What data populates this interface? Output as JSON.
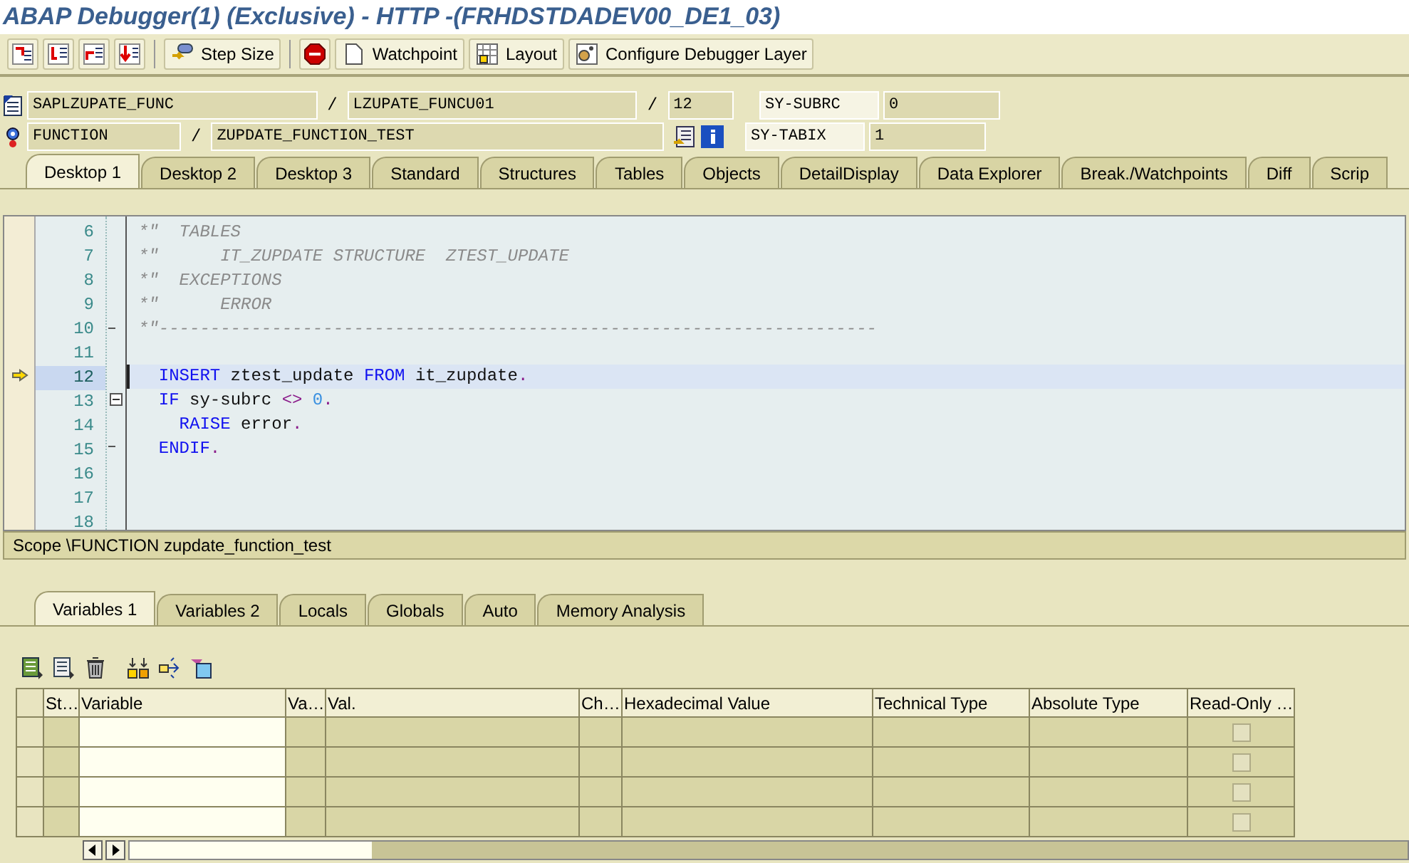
{
  "window": {
    "title": "ABAP Debugger(1)  (Exclusive) - HTTP -(FRHDSTDADEV00_DE1_03)"
  },
  "toolbar": [
    {
      "kind": "icon"
    },
    {
      "kind": "icon"
    },
    {
      "kind": "icon"
    },
    {
      "kind": "icon"
    },
    {
      "kind": "sep"
    },
    {
      "kind": "text",
      "label": "Step Size"
    },
    {
      "kind": "sep"
    },
    {
      "kind": "icon"
    },
    {
      "kind": "text",
      "label": "Watchpoint"
    },
    {
      "kind": "text",
      "label": "Layout"
    },
    {
      "kind": "text",
      "label": "Configure Debugger Layer"
    }
  ],
  "info_rows": [
    {
      "items": [
        {
          "kind": "field",
          "text": "SAPLZUPATE_FUNC"
        },
        {
          "kind": "sep",
          "text": "/"
        },
        {
          "kind": "field",
          "text": "LZUPATE_FUNCU01"
        },
        {
          "kind": "sep",
          "text": "/"
        },
        {
          "kind": "field",
          "text": "12"
        }
      ],
      "sy_name": "SY-SUBRC",
      "sy_value": "0"
    },
    {
      "items": [
        {
          "kind": "field",
          "text": "FUNCTION"
        },
        {
          "kind": "sep",
          "text": "/"
        },
        {
          "kind": "field",
          "text": "ZUPDATE_FUNCTION_TEST"
        }
      ],
      "sy_name": "SY-TABIX",
      "sy_value": "1"
    }
  ],
  "desktop_tabs": [
    {
      "label": "Desktop 1",
      "selected": true
    },
    {
      "label": "Desktop 2",
      "selected": false
    },
    {
      "label": "Desktop 3",
      "selected": false
    },
    {
      "label": "Standard",
      "selected": false
    },
    {
      "label": "Structures",
      "selected": false
    },
    {
      "label": "Tables",
      "selected": false
    },
    {
      "label": "Objects",
      "selected": false
    },
    {
      "label": "DetailDisplay",
      "selected": false
    },
    {
      "label": "Data Explorer",
      "selected": false
    },
    {
      "label": "Break./Watchpoints",
      "selected": false
    },
    {
      "label": "Diff",
      "selected": false
    },
    {
      "label": "Scrip",
      "selected": false
    }
  ],
  "code_lines": [
    {
      "number": "6",
      "current": false,
      "segments": [
        {
          "kind": "comment",
          "text": "*\"  TABLES"
        }
      ]
    },
    {
      "number": "7",
      "current": false,
      "segments": [
        {
          "kind": "comment",
          "text": "*\"      IT_ZUPDATE STRUCTURE  ZTEST_UPDATE"
        }
      ]
    },
    {
      "number": "8",
      "current": false,
      "segments": [
        {
          "kind": "comment",
          "text": "*\"  EXCEPTIONS"
        }
      ]
    },
    {
      "number": "9",
      "current": false,
      "segments": [
        {
          "kind": "comment",
          "text": "*\"      ERROR"
        }
      ]
    },
    {
      "number": "10",
      "current": false,
      "fold_end": true,
      "segments": [
        {
          "kind": "comment",
          "text": "*\"----------------------------------------------------------------------"
        }
      ]
    },
    {
      "number": "11",
      "current": false
    },
    {
      "number": "12",
      "current": true,
      "segments": [
        {
          "kind": "keyword",
          "text": "  INSERT"
        },
        {
          "kind": "plain",
          "text": " ztest_update "
        },
        {
          "kind": "keyword",
          "text": "FROM"
        },
        {
          "kind": "plain",
          "text": " it_zupdate"
        },
        {
          "kind": "operator",
          "text": "."
        }
      ]
    },
    {
      "number": "13",
      "current": false,
      "fold_open": true,
      "segments": [
        {
          "kind": "keyword",
          "text": "  IF"
        },
        {
          "kind": "plain",
          "text": " sy-subrc "
        },
        {
          "kind": "operator",
          "text": "<>"
        },
        {
          "kind": "number",
          "text": " 0"
        },
        {
          "kind": "operator",
          "text": "."
        }
      ]
    },
    {
      "number": "14",
      "current": false,
      "segments": [
        {
          "kind": "keyword",
          "text": "    RAISE"
        },
        {
          "kind": "plain",
          "text": " error"
        },
        {
          "kind": "operator",
          "text": "."
        }
      ]
    },
    {
      "number": "15",
      "current": false,
      "fold_end": true,
      "segments": [
        {
          "kind": "keyword",
          "text": "  ENDIF"
        },
        {
          "kind": "operator",
          "text": "."
        }
      ]
    },
    {
      "number": "16",
      "current": false
    },
    {
      "number": "17",
      "current": false
    },
    {
      "number": "18",
      "current": false
    }
  ],
  "scope": "Scope \\FUNCTION zupdate_function_test",
  "variable_tabs": [
    {
      "label": "Variables 1",
      "selected": true
    },
    {
      "label": "Variables 2",
      "selected": false
    },
    {
      "label": "Locals",
      "selected": false
    },
    {
      "label": "Globals",
      "selected": false
    },
    {
      "label": "Auto",
      "selected": false
    },
    {
      "label": "Memory Analysis",
      "selected": false
    }
  ],
  "table": {
    "columns": [
      {
        "label": "St…",
        "kind": "plain"
      },
      {
        "label": "Variable",
        "kind": "input"
      },
      {
        "label": "Va…",
        "kind": "plain"
      },
      {
        "label": "Val.",
        "kind": "plain"
      },
      {
        "label": "Ch…",
        "kind": "plain"
      },
      {
        "label": "Hexadecimal Value",
        "kind": "plain"
      },
      {
        "label": "Technical Type",
        "kind": "plain"
      },
      {
        "label": "Absolute Type",
        "kind": "plain"
      },
      {
        "label": "Read-Only …",
        "kind": "checkbox"
      }
    ],
    "rows": [
      {
        "read_only": false
      },
      {
        "read_only": false
      },
      {
        "read_only": false
      },
      {
        "read_only": false
      }
    ]
  }
}
